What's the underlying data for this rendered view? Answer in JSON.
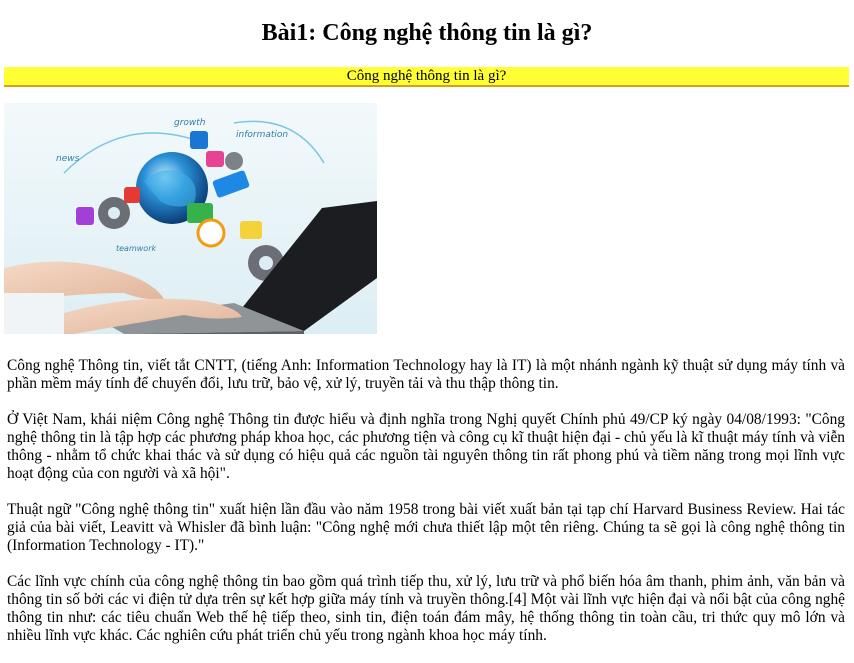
{
  "page": {
    "title": "Bài1: Công nghệ thông tin là gì?",
    "banner": "Công nghệ thông tin là gì?"
  },
  "hero_image": {
    "label_growth": "growth",
    "label_information": "information",
    "label_news": "news",
    "label_teamwork": "teamwork"
  },
  "article": {
    "paragraphs": [
      "Công nghệ Thông tin, viết tắt CNTT, (tiếng Anh: Information Technology hay là IT) là một nhánh ngành kỹ thuật sử dụng máy tính và phần mềm máy tính để chuyển đổi, lưu trữ, bảo vệ, xử lý, truyền tải và thu thập thông tin.",
      "Ở Việt Nam, khái niệm Công nghệ Thông tin được hiểu và định nghĩa trong Nghị quyết Chính phủ 49/CP ký ngày 04/08/1993: \"Công nghệ thông tin là tập hợp các phương pháp khoa học, các phương tiện và công cụ kĩ thuật hiện đại - chủ yếu là kĩ thuật máy tính và viễn thông - nhằm tổ chức khai thác và sử dụng có hiệu quả các nguồn tài nguyên thông tin rất phong phú và tiềm năng trong mọi lĩnh vực hoạt động của con người và xã hội\".",
      "Thuật ngữ \"Công nghệ thông tin\" xuất hiện lần đầu vào năm 1958 trong bài viết xuất bản tại tạp chí Harvard Business Review. Hai tác giả của bài viết, Leavitt và Whisler đã bình luận: \"Công nghệ mới chưa thiết lập một tên riêng. Chúng ta sẽ gọi là công nghệ thông tin (Information Technology - IT).\"",
      "Các lĩnh vực chính của công nghệ thông tin bao gồm quá trình tiếp thu, xử lý, lưu trữ và phổ biến hóa âm thanh, phim ảnh, văn bản và thông tin số bởi các vi điện tử dựa trên sự kết hợp giữa máy tính và truyền thông.[4] Một vài lĩnh vực hiện đại và nổi bật của công nghệ thông tin như: các tiêu chuẩn Web thế hệ tiếp theo, sinh tin, điện toán đám mây, hệ thống thông tin toàn cầu, tri thức quy mô lớn và nhiều lĩnh vực khác. Các nghiên cứu phát triển chủ yếu trong ngành khoa học máy tính."
    ]
  },
  "colors": {
    "banner_bg": "#ffff33",
    "banner_border": "#d4a017",
    "image_bg": "#e9f4f8"
  }
}
